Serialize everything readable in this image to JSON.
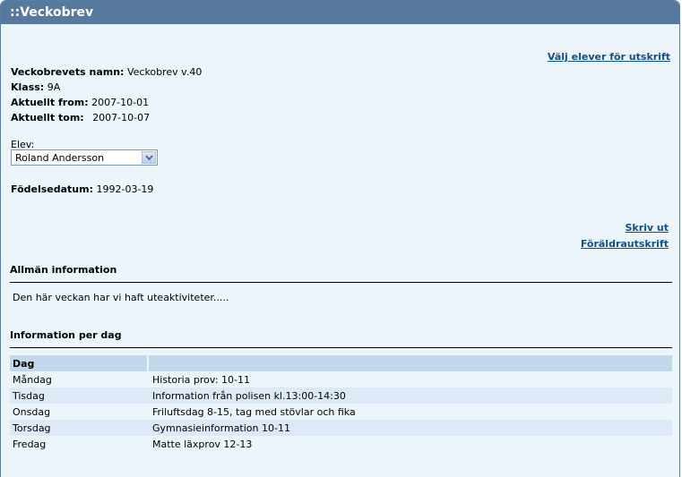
{
  "window": {
    "title": "::Veckobrev"
  },
  "links": {
    "select_students": "Välj elever för utskrift",
    "print": "Skriv ut",
    "parent_print": "Föräldrautskrift"
  },
  "info": {
    "name_label": "Veckobrevets namn:",
    "name_value": "Veckobrev v.40",
    "class_label": "Klass:",
    "class_value": "9A",
    "from_label": "Aktuellt from:",
    "from_value": "2007-10-01",
    "to_label": "Aktuellt tom:",
    "to_value": "2007-10-07"
  },
  "student": {
    "label": "Elev:",
    "selected": "Roland Andersson",
    "birth_label": "Födelsedatum:",
    "birth_value": "1992-03-19"
  },
  "general": {
    "heading": "Allmän information",
    "text": "Den här veckan har vi haft uteaktiviteter....."
  },
  "per_day": {
    "heading": "Information per dag",
    "column_day": "Dag",
    "column_info": "",
    "rows": [
      {
        "day": "Måndag",
        "info": "Historia prov: 10-11"
      },
      {
        "day": "Tisdag",
        "info": "Information från polisen kl.13:00-14:30"
      },
      {
        "day": "Onsdag",
        "info": "Friluftsdag 8-15, tag med stövlar och fika"
      },
      {
        "day": "Torsdag",
        "info": "Gymnasieinformation 10-11"
      },
      {
        "day": "Fredag",
        "info": "Matte läxprov 12-13"
      }
    ]
  }
}
